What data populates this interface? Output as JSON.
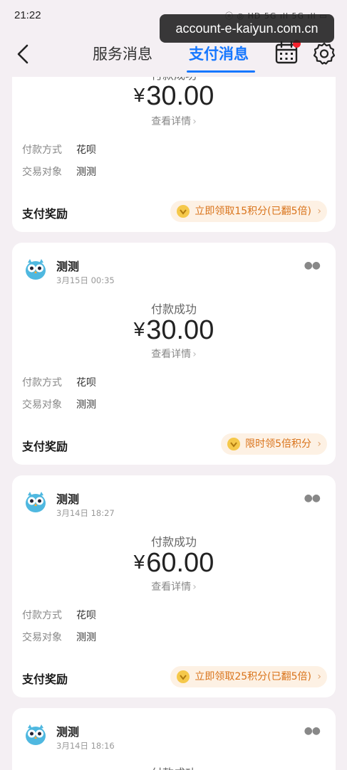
{
  "status_bar": {
    "time": "21:22",
    "icons": "ⓝ ◎ HD 5G ıll 5G ıll ▭"
  },
  "watermark": "account-e-kaiyun.com.cn",
  "nav": {
    "tabs": [
      {
        "label": "服务消息"
      },
      {
        "label": "支付消息"
      }
    ],
    "active_tab": "支付消息"
  },
  "icons": {
    "back": "back-arrow-icon",
    "calendar": "calendar-icon",
    "settings": "gear-icon",
    "coin": "coin-icon",
    "avatar": "owl-avatar"
  },
  "colors": {
    "accent": "#1677ff",
    "reward_text": "#d9731a",
    "reward_bg": "#fdf1e4",
    "badge": "#f5222d"
  },
  "cards": [
    {
      "merchant": "",
      "time": "",
      "status": "付款成功",
      "currency": "¥",
      "amount": "30.00",
      "detail_link": "查看详情",
      "rows": [
        {
          "key": "付款方式",
          "value": "花呗"
        },
        {
          "key": "交易对象",
          "value": "测测"
        }
      ],
      "reward_title": "支付奖励",
      "reward_text": "立即领取15积分(已翻5倍)"
    },
    {
      "merchant": "测测",
      "time": "3月15日 00:35",
      "status": "付款成功",
      "currency": "¥",
      "amount": "30.00",
      "detail_link": "查看详情",
      "rows": [
        {
          "key": "付款方式",
          "value": "花呗"
        },
        {
          "key": "交易对象",
          "value": "测测"
        }
      ],
      "reward_title": "支付奖励",
      "reward_text": "限时领5倍积分"
    },
    {
      "merchant": "测测",
      "time": "3月14日 18:27",
      "status": "付款成功",
      "currency": "¥",
      "amount": "60.00",
      "detail_link": "查看详情",
      "rows": [
        {
          "key": "付款方式",
          "value": "花呗"
        },
        {
          "key": "交易对象",
          "value": "测测"
        }
      ],
      "reward_title": "支付奖励",
      "reward_text": "立即领取25积分(已翻5倍)"
    },
    {
      "merchant": "测测",
      "time": "3月14日 18:16",
      "status": "付款成功"
    }
  ]
}
